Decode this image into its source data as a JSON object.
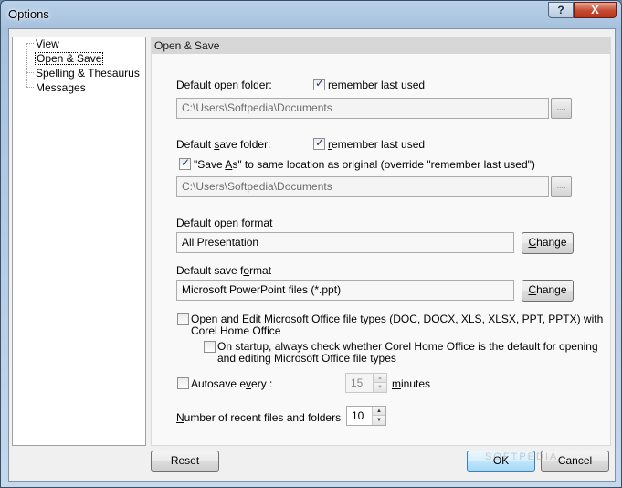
{
  "window": {
    "title": "Options",
    "help_label": "?",
    "close_label": "X"
  },
  "tree": {
    "items": [
      {
        "label": "View"
      },
      {
        "label": "Open & Save"
      },
      {
        "label": "Spelling & Thesaurus"
      },
      {
        "label": "Messages"
      }
    ],
    "selected_index": 1
  },
  "panel": {
    "header": "Open & Save",
    "open_folder": {
      "label_pre": "Default ",
      "label_u": "o",
      "label_post": "pen folder:",
      "remember_label_u": "r",
      "remember_label_rest": "emember last used",
      "remember_checked": true,
      "path": "C:\\Users\\Softpedia\\Documents",
      "browse_label": "...."
    },
    "save_folder": {
      "label_pre": "Default ",
      "label_u": "s",
      "label_post": "ave folder:",
      "remember_label_u": "r",
      "remember_label_rest": "emember last used",
      "remember_checked": true,
      "save_as_pre": "\"Save ",
      "save_as_u": "A",
      "save_as_post": "s\" to same location as original (override \"remember last used\")",
      "save_as_checked": true,
      "path": "C:\\Users\\Softpedia\\Documents",
      "browse_label": "...."
    },
    "open_format": {
      "label_pre": "Default open ",
      "label_u": "f",
      "label_post": "ormat",
      "value": "All Presentation",
      "change_label_u": "C",
      "change_label_rest": "hange"
    },
    "save_format": {
      "label_pre": "Default save f",
      "label_u": "o",
      "label_post": "rmat",
      "value": "Microsoft PowerPoint files (*.ppt)",
      "change_label_u": "C",
      "change_label_rest": "hange"
    },
    "office_types": {
      "line1": "Open and Edit Microsoft Office file types (DOC, DOCX, XLS, XLSX, PPT, PPTX) with",
      "line2": "Corel Home Office",
      "checked": false
    },
    "startup_check": {
      "line1": "On startup, always check whether Corel Home Office is the default for opening",
      "line2": "and editing Microsoft Office file types",
      "checked": false
    },
    "autosave": {
      "label_pre": "Autosave e",
      "label_u": "v",
      "label_post": "ery :",
      "checked": false,
      "value": "15",
      "unit_u": "m",
      "unit_rest": "inutes"
    },
    "recent": {
      "label_u": "N",
      "label_rest": "umber of recent files and folders",
      "value": "10"
    }
  },
  "buttons": {
    "reset": "Reset",
    "ok": "OK",
    "cancel": "Cancel"
  },
  "watermark": "SOFTPEDIA"
}
